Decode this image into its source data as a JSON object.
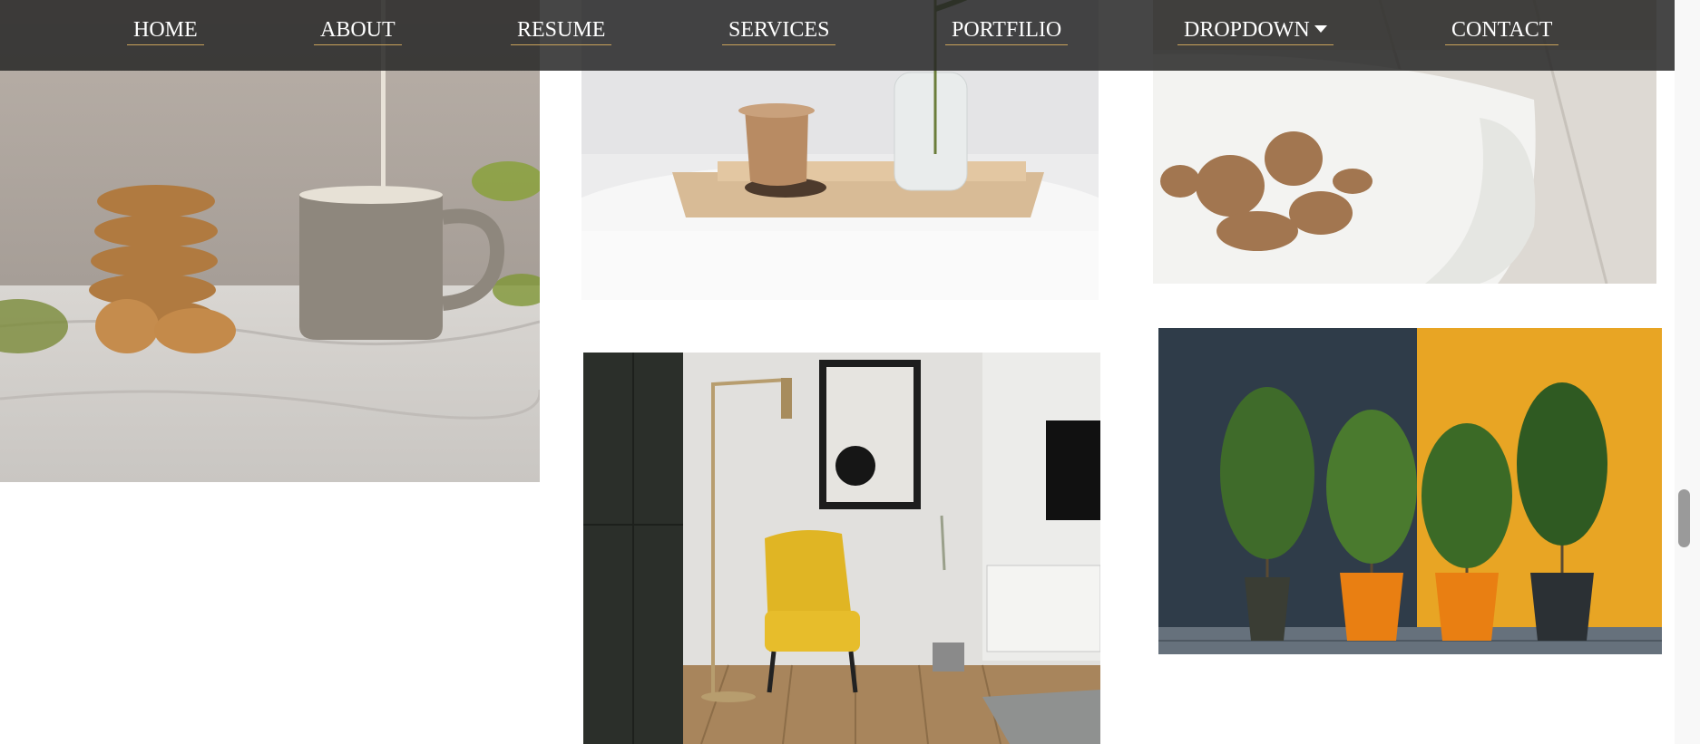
{
  "nav": {
    "items": [
      {
        "label": "HOME"
      },
      {
        "label": "ABOUT"
      },
      {
        "label": "RESUME"
      },
      {
        "label": "SERVICES"
      },
      {
        "label": "PORTFILIO"
      },
      {
        "label": "DROPDOWN"
      },
      {
        "label": "CONTACT"
      }
    ],
    "accent_color": "#c9a25a",
    "background": "#262626"
  },
  "portfolio": {
    "images": [
      {
        "subject": "cookies-and-mug"
      },
      {
        "subject": "wooden-cup-on-tray"
      },
      {
        "subject": "walnuts-on-plate"
      },
      {
        "subject": "yellow-armchair-room"
      },
      {
        "subject": "potted-trees"
      }
    ]
  },
  "icons": {
    "dropdown": "caret-down-icon"
  }
}
